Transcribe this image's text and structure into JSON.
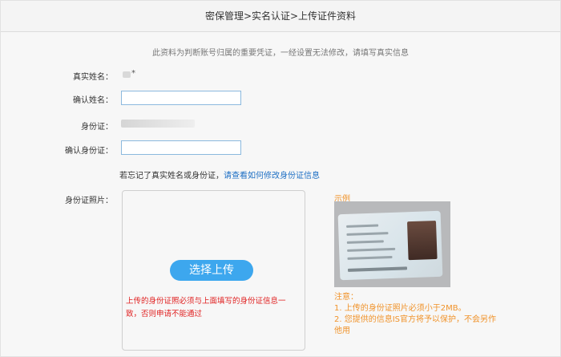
{
  "header": {
    "title": "密保管理>实名认证>上传证件资料"
  },
  "notice": "此资料为判断账号归属的重要凭证，一经设置无法修改，请填写真实信息",
  "form": {
    "real_name_label": "真实姓名：",
    "real_name_suffix": "*",
    "confirm_name_label": "确认姓名：",
    "confirm_name_value": "",
    "id_label": "身份证：",
    "confirm_id_label": "确认身份证：",
    "confirm_id_value": "",
    "forgot_text": "若忘记了真实姓名或身份证，",
    "forgot_link": "请查看如何修改身份证信息"
  },
  "upload": {
    "label": "身份证照片：",
    "button": "选择上传",
    "warning": "上传的身份证照必须与上面填写的身份证信息一致，否则申请不能通过"
  },
  "example": {
    "title": "示例",
    "notes_title": "注意：",
    "notes": [
      "1. 上传的身份证照片必须小于2MB。",
      "2. 您提供的信息IS官方将予以保护，不会另作他用"
    ]
  },
  "colors": {
    "accent": "#3da7ee",
    "warning": "#e02020",
    "hint": "#f0932b",
    "link": "#1d6fc4"
  }
}
